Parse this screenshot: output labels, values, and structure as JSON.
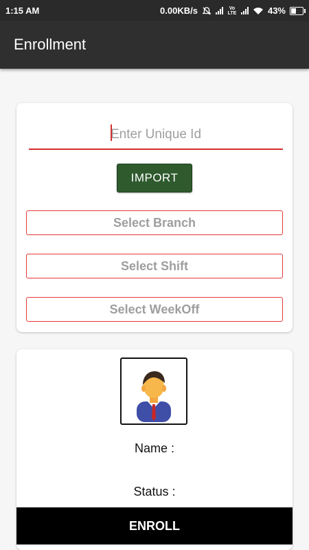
{
  "statusbar": {
    "time": "1:15 AM",
    "network_speed": "0.00KB/s",
    "volte": "Vo LTE",
    "battery": "43%"
  },
  "appbar": {
    "title": "Enrollment"
  },
  "form": {
    "uid_placeholder": "Enter Unique Id",
    "uid_value": "",
    "import_label": "IMPORT",
    "branch_label": "Select Branch",
    "shift_label": "Select Shift",
    "weekoff_label": "Select WeekOff"
  },
  "profile": {
    "avatar_icon": "person-avatar-icon",
    "name_label": "Name :",
    "status_label": "Status :",
    "enroll_label": "ENROLL"
  },
  "colors": {
    "accent_red": "#e53935",
    "import_green": "#2e5a2e",
    "appbar": "#2f2f2f",
    "enroll_bg": "#000000"
  }
}
